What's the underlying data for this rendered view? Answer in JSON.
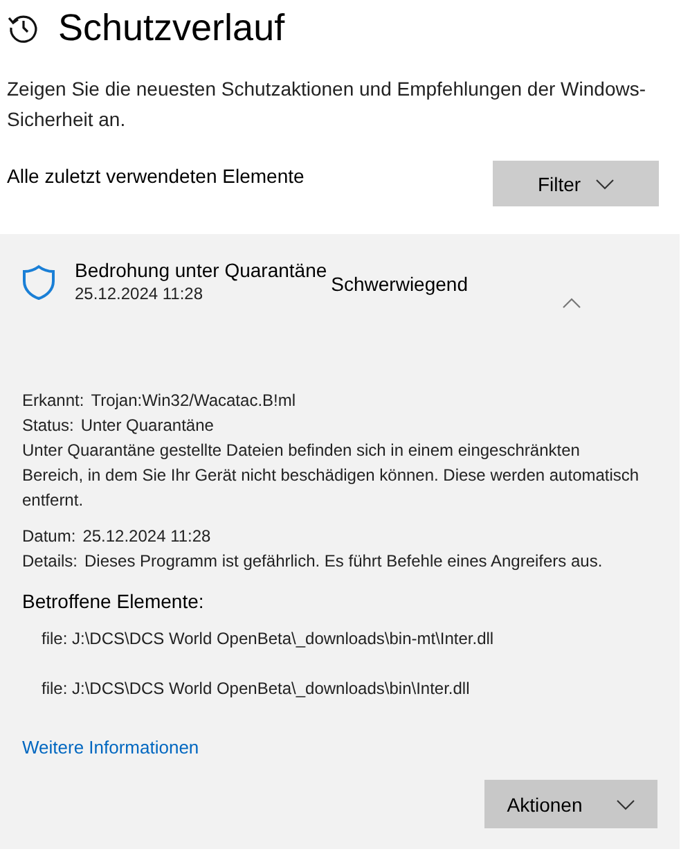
{
  "page": {
    "title": "Schutzverlauf",
    "description": "Zeigen Sie die neuesten Schutzaktionen und Empfehlungen der Windows-Sicherheit an."
  },
  "filter_row": {
    "label": "Alle zuletzt verwendeten Elemente",
    "button": "Filter"
  },
  "event": {
    "title": "Bedrohung unter Quarantäne",
    "date": "25.12.2024 11:28",
    "severity": "Schwerwiegend",
    "expanded": true,
    "details": [
      {
        "kind": "pair",
        "label": "Erkannt:",
        "value": "Trojan:Win32/Wacatac.B!ml"
      },
      {
        "kind": "pair",
        "label": "Status:",
        "value": "Unter Quarantäne"
      },
      {
        "kind": "note",
        "text": "Unter Quarantäne gestellte Dateien befinden sich in einem eingeschränkten Bereich, in dem Sie Ihr Gerät nicht beschädigen können. Diese werden automatisch entfernt."
      },
      {
        "kind": "pair",
        "label": "Datum:",
        "value": "25.12.2024 11:28"
      },
      {
        "kind": "pair",
        "label": "Details:",
        "value": "Dieses Programm ist gefährlich. Es führt Befehle eines Angreifers aus."
      }
    ],
    "affected_heading": "Betroffene Elemente:",
    "affected_items": [
      "file: J:\\DCS\\DCS World OpenBeta\\_downloads\\bin-mt\\Inter.dll",
      "file: J:\\DCS\\DCS World OpenBeta\\_downloads\\bin\\Inter.dll"
    ],
    "link": "Weitere Informationen",
    "actions_button": "Aktionen"
  }
}
